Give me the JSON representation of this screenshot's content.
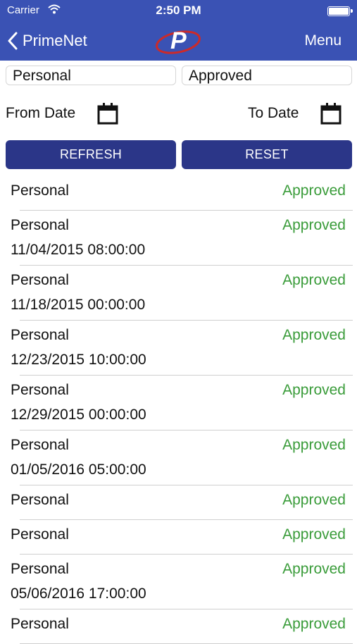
{
  "status_bar": {
    "carrier": "Carrier",
    "time": "2:50 PM"
  },
  "nav": {
    "back_label": "PrimeNet",
    "logo_letter": "P",
    "menu_label": "Menu"
  },
  "filters": {
    "type_value": "Personal",
    "status_value": "Approved"
  },
  "dates": {
    "from_label": "From Date",
    "to_label": "To Date"
  },
  "buttons": {
    "refresh_label": "REFRESH",
    "reset_label": "RESET"
  },
  "colors": {
    "nav_bar": "#3a52b4",
    "button": "#2b3688",
    "approved": "#3a9c3a",
    "logo_red": "#cc2a2a"
  },
  "items": [
    {
      "type": "Personal",
      "status": "Approved",
      "date": ""
    },
    {
      "type": "Personal",
      "status": "Approved",
      "date": "11/04/2015 08:00:00"
    },
    {
      "type": "Personal",
      "status": "Approved",
      "date": "11/18/2015 00:00:00"
    },
    {
      "type": "Personal",
      "status": "Approved",
      "date": "12/23/2015 10:00:00"
    },
    {
      "type": "Personal",
      "status": "Approved",
      "date": "12/29/2015 00:00:00"
    },
    {
      "type": "Personal",
      "status": "Approved",
      "date": "01/05/2016 05:00:00"
    },
    {
      "type": "Personal",
      "status": "Approved",
      "date": ""
    },
    {
      "type": "Personal",
      "status": "Approved",
      "date": ""
    },
    {
      "type": "Personal",
      "status": "Approved",
      "date": "05/06/2016 17:00:00"
    },
    {
      "type": "Personal",
      "status": "Approved",
      "date": ""
    }
  ]
}
